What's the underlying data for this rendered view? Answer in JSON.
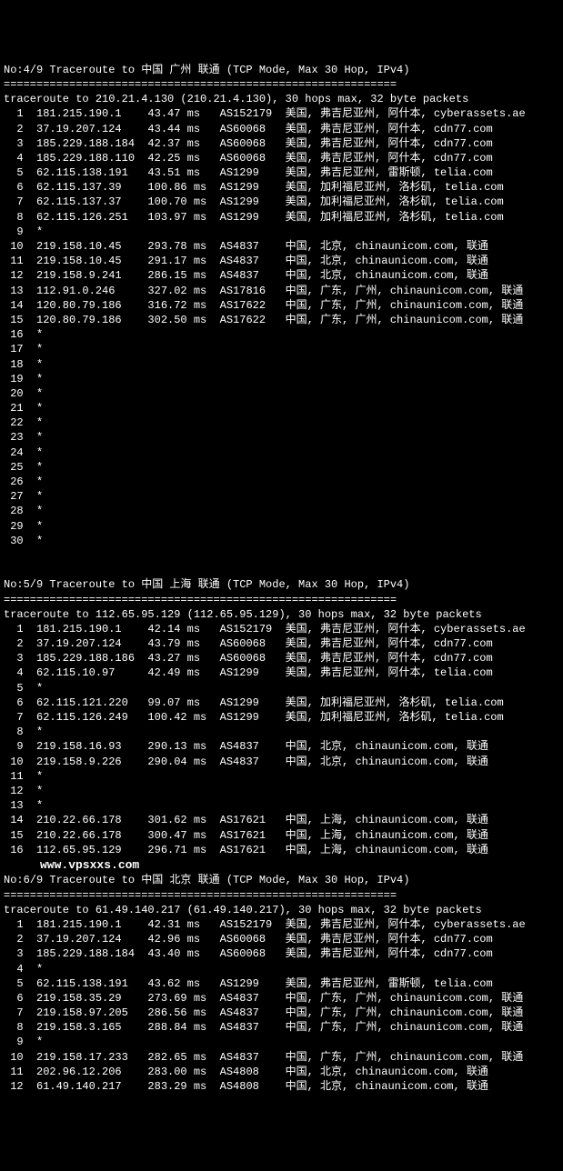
{
  "blocks": [
    {
      "header": "No:4/9 Traceroute to 中国 广州 联通 (TCP Mode, Max 30 Hop, IPv4)",
      "sep": "============================================================",
      "summary": "traceroute to 210.21.4.130 (210.21.4.130), 30 hops max, 32 byte packets",
      "hops": [
        {
          "n": 1,
          "ip": "181.215.190.1",
          "ms": "43.47 ms",
          "asn": "AS152179",
          "loc": "美国, 弗吉尼亚州, 阿什本, cyberassets.ae"
        },
        {
          "n": 2,
          "ip": "37.19.207.124",
          "ms": "43.44 ms",
          "asn": "AS60068",
          "loc": "美国, 弗吉尼亚州, 阿什本, cdn77.com"
        },
        {
          "n": 3,
          "ip": "185.229.188.184",
          "ms": "42.37 ms",
          "asn": "AS60068",
          "loc": "美国, 弗吉尼亚州, 阿什本, cdn77.com"
        },
        {
          "n": 4,
          "ip": "185.229.188.110",
          "ms": "42.25 ms",
          "asn": "AS60068",
          "loc": "美国, 弗吉尼亚州, 阿什本, cdn77.com"
        },
        {
          "n": 5,
          "ip": "62.115.138.191",
          "ms": "43.51 ms",
          "asn": "AS1299",
          "loc": "美国, 弗吉尼亚州, 雷斯顿, telia.com"
        },
        {
          "n": 6,
          "ip": "62.115.137.39",
          "ms": "100.86 ms",
          "asn": "AS1299",
          "loc": "美国, 加利福尼亚州, 洛杉矶, telia.com"
        },
        {
          "n": 7,
          "ip": "62.115.137.37",
          "ms": "100.70 ms",
          "asn": "AS1299",
          "loc": "美国, 加利福尼亚州, 洛杉矶, telia.com"
        },
        {
          "n": 8,
          "ip": "62.115.126.251",
          "ms": "103.97 ms",
          "asn": "AS1299",
          "loc": "美国, 加利福尼亚州, 洛杉矶, telia.com"
        },
        {
          "n": 9,
          "star": true
        },
        {
          "n": 10,
          "ip": "219.158.10.45",
          "ms": "293.78 ms",
          "asn": "AS4837",
          "loc": "中国, 北京, chinaunicom.com, 联通"
        },
        {
          "n": 11,
          "ip": "219.158.10.45",
          "ms": "291.17 ms",
          "asn": "AS4837",
          "loc": "中国, 北京, chinaunicom.com, 联通"
        },
        {
          "n": 12,
          "ip": "219.158.9.241",
          "ms": "286.15 ms",
          "asn": "AS4837",
          "loc": "中国, 北京, chinaunicom.com, 联通"
        },
        {
          "n": 13,
          "ip": "112.91.0.246",
          "ms": "327.02 ms",
          "asn": "AS17816",
          "loc": "中国, 广东, 广州, chinaunicom.com, 联通"
        },
        {
          "n": 14,
          "ip": "120.80.79.186",
          "ms": "316.72 ms",
          "asn": "AS17622",
          "loc": "中国, 广东, 广州, chinaunicom.com, 联通"
        },
        {
          "n": 15,
          "ip": "120.80.79.186",
          "ms": "302.50 ms",
          "asn": "AS17622",
          "loc": "中国, 广东, 广州, chinaunicom.com, 联通"
        },
        {
          "n": 16,
          "star": true
        },
        {
          "n": 17,
          "star": true
        },
        {
          "n": 18,
          "star": true
        },
        {
          "n": 19,
          "star": true
        },
        {
          "n": 20,
          "star": true
        },
        {
          "n": 21,
          "star": true
        },
        {
          "n": 22,
          "star": true
        },
        {
          "n": 23,
          "star": true
        },
        {
          "n": 24,
          "star": true
        },
        {
          "n": 25,
          "star": true
        },
        {
          "n": 26,
          "star": true
        },
        {
          "n": 27,
          "star": true
        },
        {
          "n": 28,
          "star": true
        },
        {
          "n": 29,
          "star": true
        },
        {
          "n": 30,
          "star": true
        }
      ]
    },
    {
      "header": "No:5/9 Traceroute to 中国 上海 联通 (TCP Mode, Max 30 Hop, IPv4)",
      "sep": "============================================================",
      "summary": "traceroute to 112.65.95.129 (112.65.95.129), 30 hops max, 32 byte packets",
      "hops": [
        {
          "n": 1,
          "ip": "181.215.190.1",
          "ms": "42.14 ms",
          "asn": "AS152179",
          "loc": "美国, 弗吉尼亚州, 阿什本, cyberassets.ae"
        },
        {
          "n": 2,
          "ip": "37.19.207.124",
          "ms": "43.79 ms",
          "asn": "AS60068",
          "loc": "美国, 弗吉尼亚州, 阿什本, cdn77.com"
        },
        {
          "n": 3,
          "ip": "185.229.188.186",
          "ms": "43.27 ms",
          "asn": "AS60068",
          "loc": "美国, 弗吉尼亚州, 阿什本, cdn77.com"
        },
        {
          "n": 4,
          "ip": "62.115.10.97",
          "ms": "42.49 ms",
          "asn": "AS1299",
          "loc": "美国, 弗吉尼亚州, 阿什本, telia.com"
        },
        {
          "n": 5,
          "star": true
        },
        {
          "n": 6,
          "ip": "62.115.121.220",
          "ms": "99.07 ms",
          "asn": "AS1299",
          "loc": "美国, 加利福尼亚州, 洛杉矶, telia.com"
        },
        {
          "n": 7,
          "ip": "62.115.126.249",
          "ms": "100.42 ms",
          "asn": "AS1299",
          "loc": "美国, 加利福尼亚州, 洛杉矶, telia.com"
        },
        {
          "n": 8,
          "star": true
        },
        {
          "n": 9,
          "ip": "219.158.16.93",
          "ms": "290.13 ms",
          "asn": "AS4837",
          "loc": "中国, 北京, chinaunicom.com, 联通"
        },
        {
          "n": 10,
          "ip": "219.158.9.226",
          "ms": "290.04 ms",
          "asn": "AS4837",
          "loc": "中国, 北京, chinaunicom.com, 联通"
        },
        {
          "n": 11,
          "star": true
        },
        {
          "n": 12,
          "star": true
        },
        {
          "n": 13,
          "star": true
        },
        {
          "n": 14,
          "ip": "210.22.66.178",
          "ms": "301.62 ms",
          "asn": "AS17621",
          "loc": "中国, 上海, chinaunicom.com, 联通"
        },
        {
          "n": 15,
          "ip": "210.22.66.178",
          "ms": "300.47 ms",
          "asn": "AS17621",
          "loc": "中国, 上海, chinaunicom.com, 联通"
        },
        {
          "n": 16,
          "ip": "112.65.95.129",
          "ms": "296.71 ms",
          "asn": "AS17621",
          "loc": "中国, 上海, chinaunicom.com, 联通"
        }
      ],
      "watermark_after": "www.vpsxxs.com"
    },
    {
      "header": "No:6/9 Traceroute to 中国 北京 联通 (TCP Mode, Max 30 Hop, IPv4)",
      "sep": "============================================================",
      "summary": "traceroute to 61.49.140.217 (61.49.140.217), 30 hops max, 32 byte packets",
      "hops": [
        {
          "n": 1,
          "ip": "181.215.190.1",
          "ms": "42.31 ms",
          "asn": "AS152179",
          "loc": "美国, 弗吉尼亚州, 阿什本, cyberassets.ae"
        },
        {
          "n": 2,
          "ip": "37.19.207.124",
          "ms": "42.96 ms",
          "asn": "AS60068",
          "loc": "美国, 弗吉尼亚州, 阿什本, cdn77.com"
        },
        {
          "n": 3,
          "ip": "185.229.188.184",
          "ms": "43.40 ms",
          "asn": "AS60068",
          "loc": "美国, 弗吉尼亚州, 阿什本, cdn77.com"
        },
        {
          "n": 4,
          "star": true
        },
        {
          "n": 5,
          "ip": "62.115.138.191",
          "ms": "43.62 ms",
          "asn": "AS1299",
          "loc": "美国, 弗吉尼亚州, 雷斯顿, telia.com"
        },
        {
          "n": 6,
          "ip": "219.158.35.29",
          "ms": "273.69 ms",
          "asn": "AS4837",
          "loc": "中国, 广东, 广州, chinaunicom.com, 联通"
        },
        {
          "n": 7,
          "ip": "219.158.97.205",
          "ms": "286.56 ms",
          "asn": "AS4837",
          "loc": "中国, 广东, 广州, chinaunicom.com, 联通"
        },
        {
          "n": 8,
          "ip": "219.158.3.165",
          "ms": "288.84 ms",
          "asn": "AS4837",
          "loc": "中国, 广东, 广州, chinaunicom.com, 联通"
        },
        {
          "n": 9,
          "star": true
        },
        {
          "n": 10,
          "ip": "219.158.17.233",
          "ms": "282.65 ms",
          "asn": "AS4837",
          "loc": "中国, 广东, 广州, chinaunicom.com, 联通"
        },
        {
          "n": 11,
          "ip": "202.96.12.206",
          "ms": "283.00 ms",
          "asn": "AS4808",
          "loc": "中国, 北京, chinaunicom.com, 联通"
        },
        {
          "n": 12,
          "ip": "61.49.140.217",
          "ms": "283.29 ms",
          "asn": "AS4808",
          "loc": "中国, 北京, chinaunicom.com, 联通"
        }
      ]
    }
  ]
}
